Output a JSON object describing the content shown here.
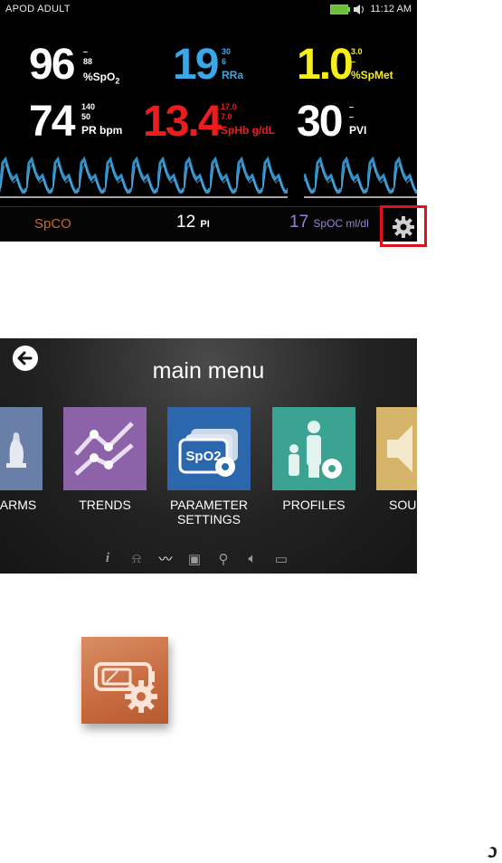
{
  "status": {
    "left": "APOD   ADULT",
    "time": "11:12 AM"
  },
  "params": {
    "spo2": {
      "value": "96",
      "high": "–",
      "low": "88",
      "unit": "%SpO",
      "sub": "2"
    },
    "rra": {
      "value": "19",
      "high": "30",
      "low": "6",
      "unit": "RRa"
    },
    "spmet": {
      "value": "1.0",
      "high": "3.0",
      "low": "–",
      "unit": "%SpMet"
    },
    "pr": {
      "value": "74",
      "high": "140",
      "low": "50",
      "unit": "PR bpm"
    },
    "sphb": {
      "value": "13.4",
      "high": "17.0",
      "low": "7.0",
      "unit": "SpHb g/dL"
    },
    "pvi": {
      "value": "30",
      "high": "–",
      "low": "–",
      "unit": "PVI"
    }
  },
  "bottom": {
    "spco": "SpCO",
    "pi_value": "12",
    "pi_label": "PI",
    "spoc_value": "17",
    "spoc_label": "SpOC ml/dl"
  },
  "menu": {
    "title": "main menu",
    "tiles": [
      {
        "label": "ARMS",
        "color": "#6a7fa8"
      },
      {
        "label": "TRENDS",
        "color": "#8c62a8"
      },
      {
        "label": "PARAMETER\nSETTINGS",
        "color": "#2b67ad"
      },
      {
        "label": "PROFILES",
        "color": "#3aa392"
      },
      {
        "label": "SOU",
        "color": "#d6b46a"
      }
    ],
    "bottom_icons": [
      "info-icon",
      "alarm-icon",
      "trends-icon",
      "parameter-settings-icon",
      "profiles-icon",
      "sound-icon",
      "device-settings-icon"
    ]
  },
  "icons": {
    "gear": "gear-icon",
    "standalone": "device-settings-icon"
  }
}
